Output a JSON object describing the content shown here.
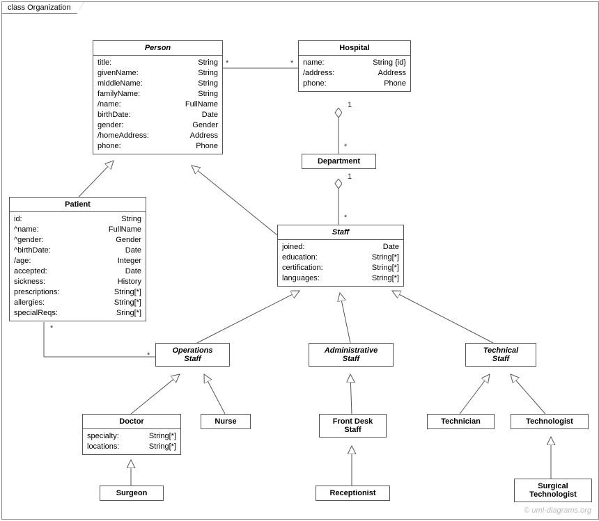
{
  "frame": {
    "title": "class Organization"
  },
  "watermark": "© uml-diagrams.org",
  "classes": {
    "person": {
      "name": "Person",
      "attrs": [
        [
          "title:",
          "String"
        ],
        [
          "givenName:",
          "String"
        ],
        [
          "middleName:",
          "String"
        ],
        [
          "familyName:",
          "String"
        ],
        [
          "/name:",
          "FullName"
        ],
        [
          "birthDate:",
          "Date"
        ],
        [
          "gender:",
          "Gender"
        ],
        [
          "/homeAddress:",
          "Address"
        ],
        [
          "phone:",
          "Phone"
        ]
      ]
    },
    "hospital": {
      "name": "Hospital",
      "attrs": [
        [
          "name:",
          "String {id}"
        ],
        [
          "/address:",
          "Address"
        ],
        [
          "phone:",
          "Phone"
        ]
      ]
    },
    "department": {
      "name": "Department"
    },
    "patient": {
      "name": "Patient",
      "attrs": [
        [
          "id:",
          "String"
        ],
        [
          "^name:",
          "FullName"
        ],
        [
          "^gender:",
          "Gender"
        ],
        [
          "^birthDate:",
          "Date"
        ],
        [
          "/age:",
          "Integer"
        ],
        [
          "accepted:",
          "Date"
        ],
        [
          "sickness:",
          "History"
        ],
        [
          "prescriptions:",
          "String[*]"
        ],
        [
          "allergies:",
          "String[*]"
        ],
        [
          "specialReqs:",
          "Sring[*]"
        ]
      ]
    },
    "staff": {
      "name": "Staff",
      "attrs": [
        [
          "joined:",
          "Date"
        ],
        [
          "education:",
          "String[*]"
        ],
        [
          "certification:",
          "String[*]"
        ],
        [
          "languages:",
          "String[*]"
        ]
      ]
    },
    "opsStaff": {
      "name": "Operations\nStaff"
    },
    "adminStaff": {
      "name": "Administrative\nStaff"
    },
    "techStaff": {
      "name": "Technical\nStaff"
    },
    "doctor": {
      "name": "Doctor",
      "attrs": [
        [
          "specialty:",
          "String[*]"
        ],
        [
          "locations:",
          "String[*]"
        ]
      ]
    },
    "nurse": {
      "name": "Nurse"
    },
    "frontDesk": {
      "name": "Front Desk\nStaff"
    },
    "technician": {
      "name": "Technician"
    },
    "technologist": {
      "name": "Technologist"
    },
    "surgeon": {
      "name": "Surgeon"
    },
    "receptionist": {
      "name": "Receptionist"
    },
    "surgTech": {
      "name": "Surgical\nTechnologist"
    }
  },
  "multiplicities": {
    "personHospL": "*",
    "personHospR": "*",
    "hospDeptTop": "1",
    "hospDeptBot": "*",
    "deptStaffTop": "1",
    "deptStaffBot": "*",
    "patientOpsL": "*",
    "patientOpsR": "*"
  }
}
